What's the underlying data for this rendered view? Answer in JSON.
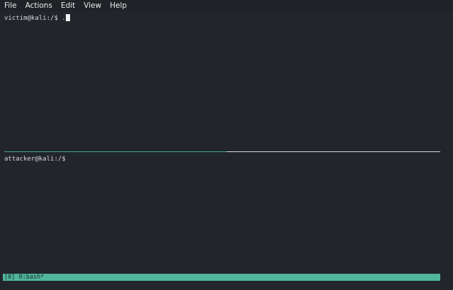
{
  "menubar": {
    "items": [
      "File",
      "Actions",
      "Edit",
      "View",
      "Help"
    ]
  },
  "panes": {
    "top": {
      "prompt": "victim@kali:/$ ",
      "input": "."
    },
    "bottom": {
      "prompt": "attacker@kali:/$",
      "input": ""
    }
  },
  "statusbar": {
    "text": "[0] 0:bash*"
  },
  "colors": {
    "background": "#22252a",
    "status_accent": "#4fb59b",
    "active_divider": "#3fa88c"
  }
}
